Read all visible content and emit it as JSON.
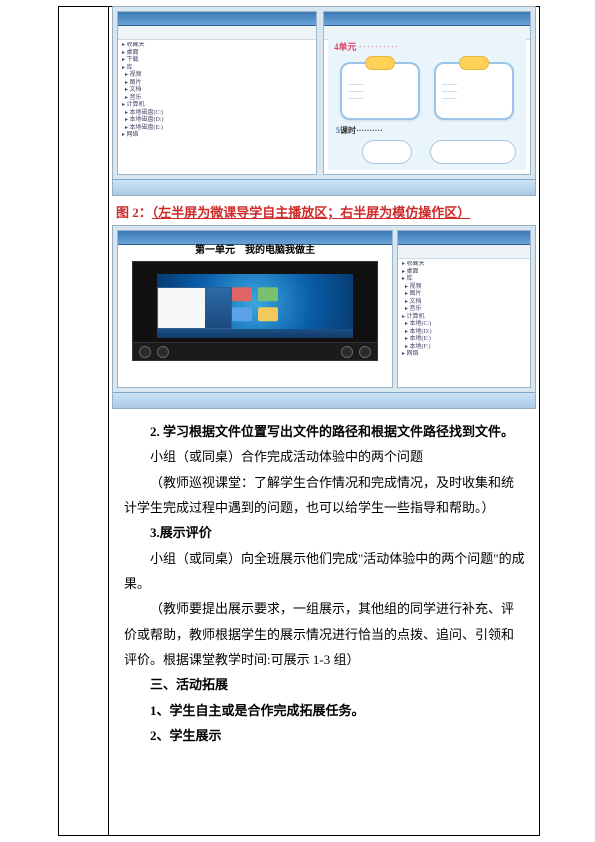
{
  "shot1": {
    "banner": "4单元",
    "fiveLabel": "5",
    "fiveSuffix": "课时··········"
  },
  "caption": {
    "label": "图 2：",
    "desc": "（左半屏为微课导学自主播放区；右半屏为模仿操作区）"
  },
  "shot2": {
    "videoTitle": "第一单元　我的电脑我做主"
  },
  "text": {
    "p1": "2. 学习根据文件位置写出文件的路径和根据文件路径找到文件。",
    "p2": "小组（或同桌）合作完成活动体验中的两个问题",
    "p3": "（教师巡视课堂：了解学生合作情况和完成情况，及时收集和统计学生完成过程中遇到的问题，也可以给学生一些指导和帮助。）",
    "p4": "3.展示评价",
    "p5": "小组（或同桌）向全班展示他们完成\"活动体验中的两个问题\"的成果。",
    "p6": "（教师要提出展示要求，一组展示，其他组的同学进行补充、评价或帮助，教师根据学生的展示情况进行恰当的点拨、追问、引领和评价。根据课堂教学时间:可展示 1-3 组）",
    "p7": "三、活动拓展",
    "p8": "1、学生自主或是合作完成拓展任务。",
    "p9": "2、学生展示"
  }
}
